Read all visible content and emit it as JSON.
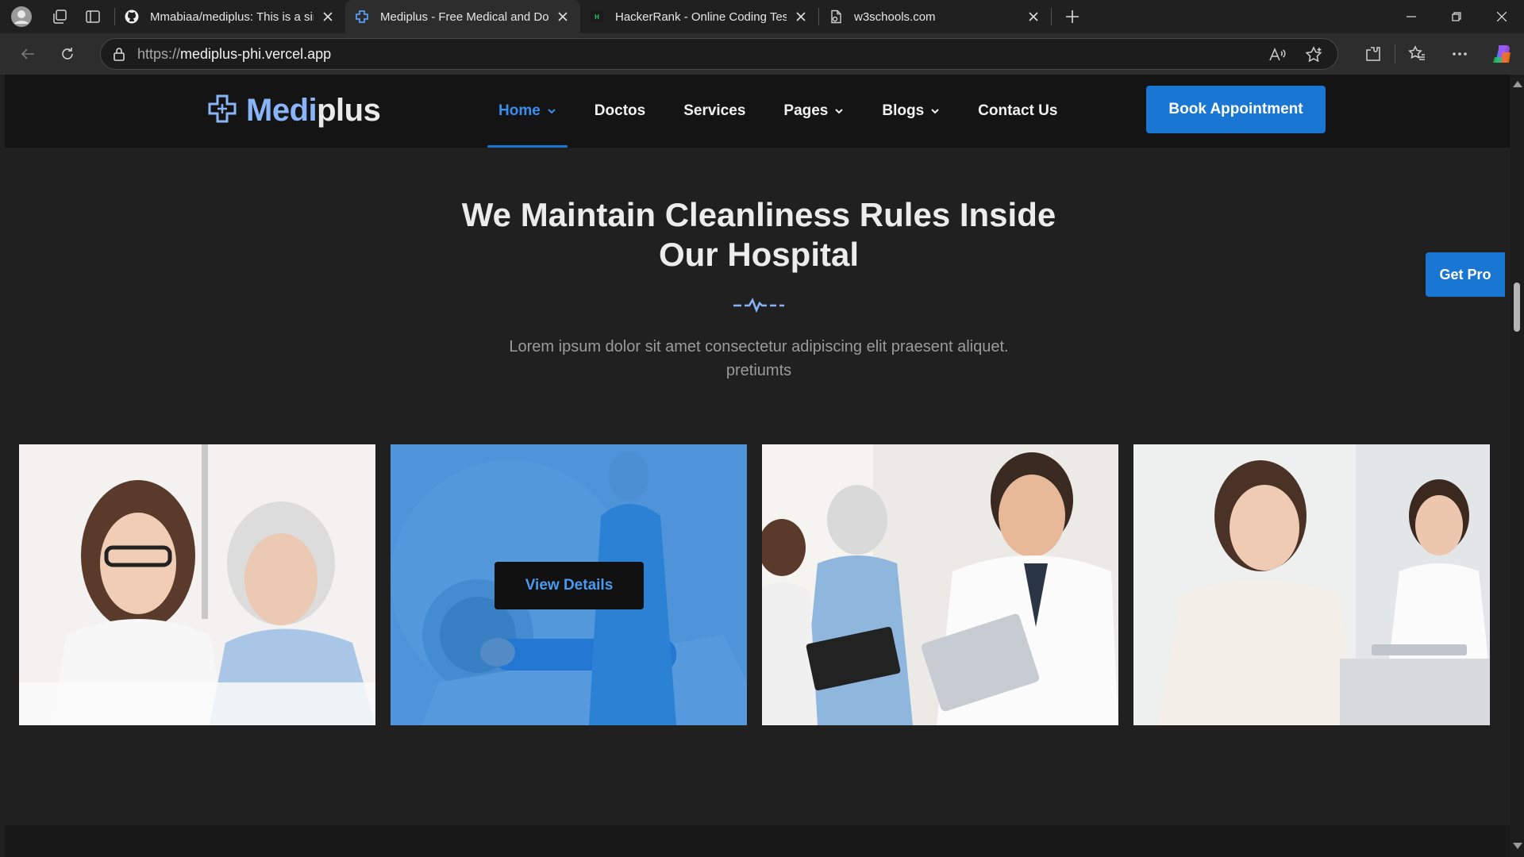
{
  "browser": {
    "tabs": [
      {
        "title": "Mmabiaa/mediplus: This is a simp",
        "icon": "github-icon",
        "active": false
      },
      {
        "title": "Mediplus - Free Medical and Doct",
        "icon": "mediplus-cross-icon",
        "active": true
      },
      {
        "title": "HackerRank - Online Coding Test",
        "icon": "hackerrank-icon",
        "active": false
      },
      {
        "title": "w3schools.com",
        "icon": "page-icon",
        "active": false
      }
    ],
    "url_protocol": "https://",
    "url_host": "mediplus-phi.vercel.app"
  },
  "site": {
    "logo_part1": "Medi",
    "logo_part2": "plus",
    "nav": [
      {
        "label": "Home",
        "dropdown": true,
        "active": true
      },
      {
        "label": "Doctos",
        "dropdown": false,
        "active": false
      },
      {
        "label": "Services",
        "dropdown": false,
        "active": false
      },
      {
        "label": "Pages",
        "dropdown": true,
        "active": false
      },
      {
        "label": "Blogs",
        "dropdown": true,
        "active": false
      },
      {
        "label": "Contact Us",
        "dropdown": false,
        "active": false
      }
    ],
    "book_button": "Book Appointment",
    "get_pro": "Get Pro"
  },
  "section": {
    "title_line1": "We Maintain Cleanliness Rules Inside",
    "title_line2": "Our Hospital",
    "desc_line1": "Lorem ipsum dolor sit amet consectetur adipiscing elit praesent aliquet.",
    "desc_line2": "pretiumts"
  },
  "gallery": {
    "view_details": "View Details"
  },
  "colors": {
    "brand_blue": "#1976d2",
    "link_blue": "#3b8df0",
    "logo_accent": "#8ab4f8",
    "page_bg": "#202020",
    "header_bg": "#141414"
  }
}
